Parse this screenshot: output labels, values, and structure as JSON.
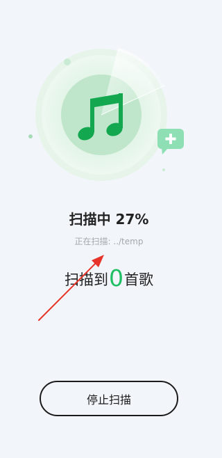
{
  "scan": {
    "title_prefix": "扫描中 ",
    "progress_percent": "27%",
    "path_label": "正在扫描: ../temp",
    "count_prefix": "扫描到",
    "count_value": "0",
    "count_suffix": "首歌"
  },
  "actions": {
    "stop_label": "停止扫描"
  },
  "icons": {
    "center": "music-note-icon",
    "side": "add-chat-bubble-icon"
  },
  "colors": {
    "accent": "#1fbf63",
    "note": "#13a850",
    "background": "#f2f6fa",
    "annotation_arrow": "#e8332a"
  }
}
